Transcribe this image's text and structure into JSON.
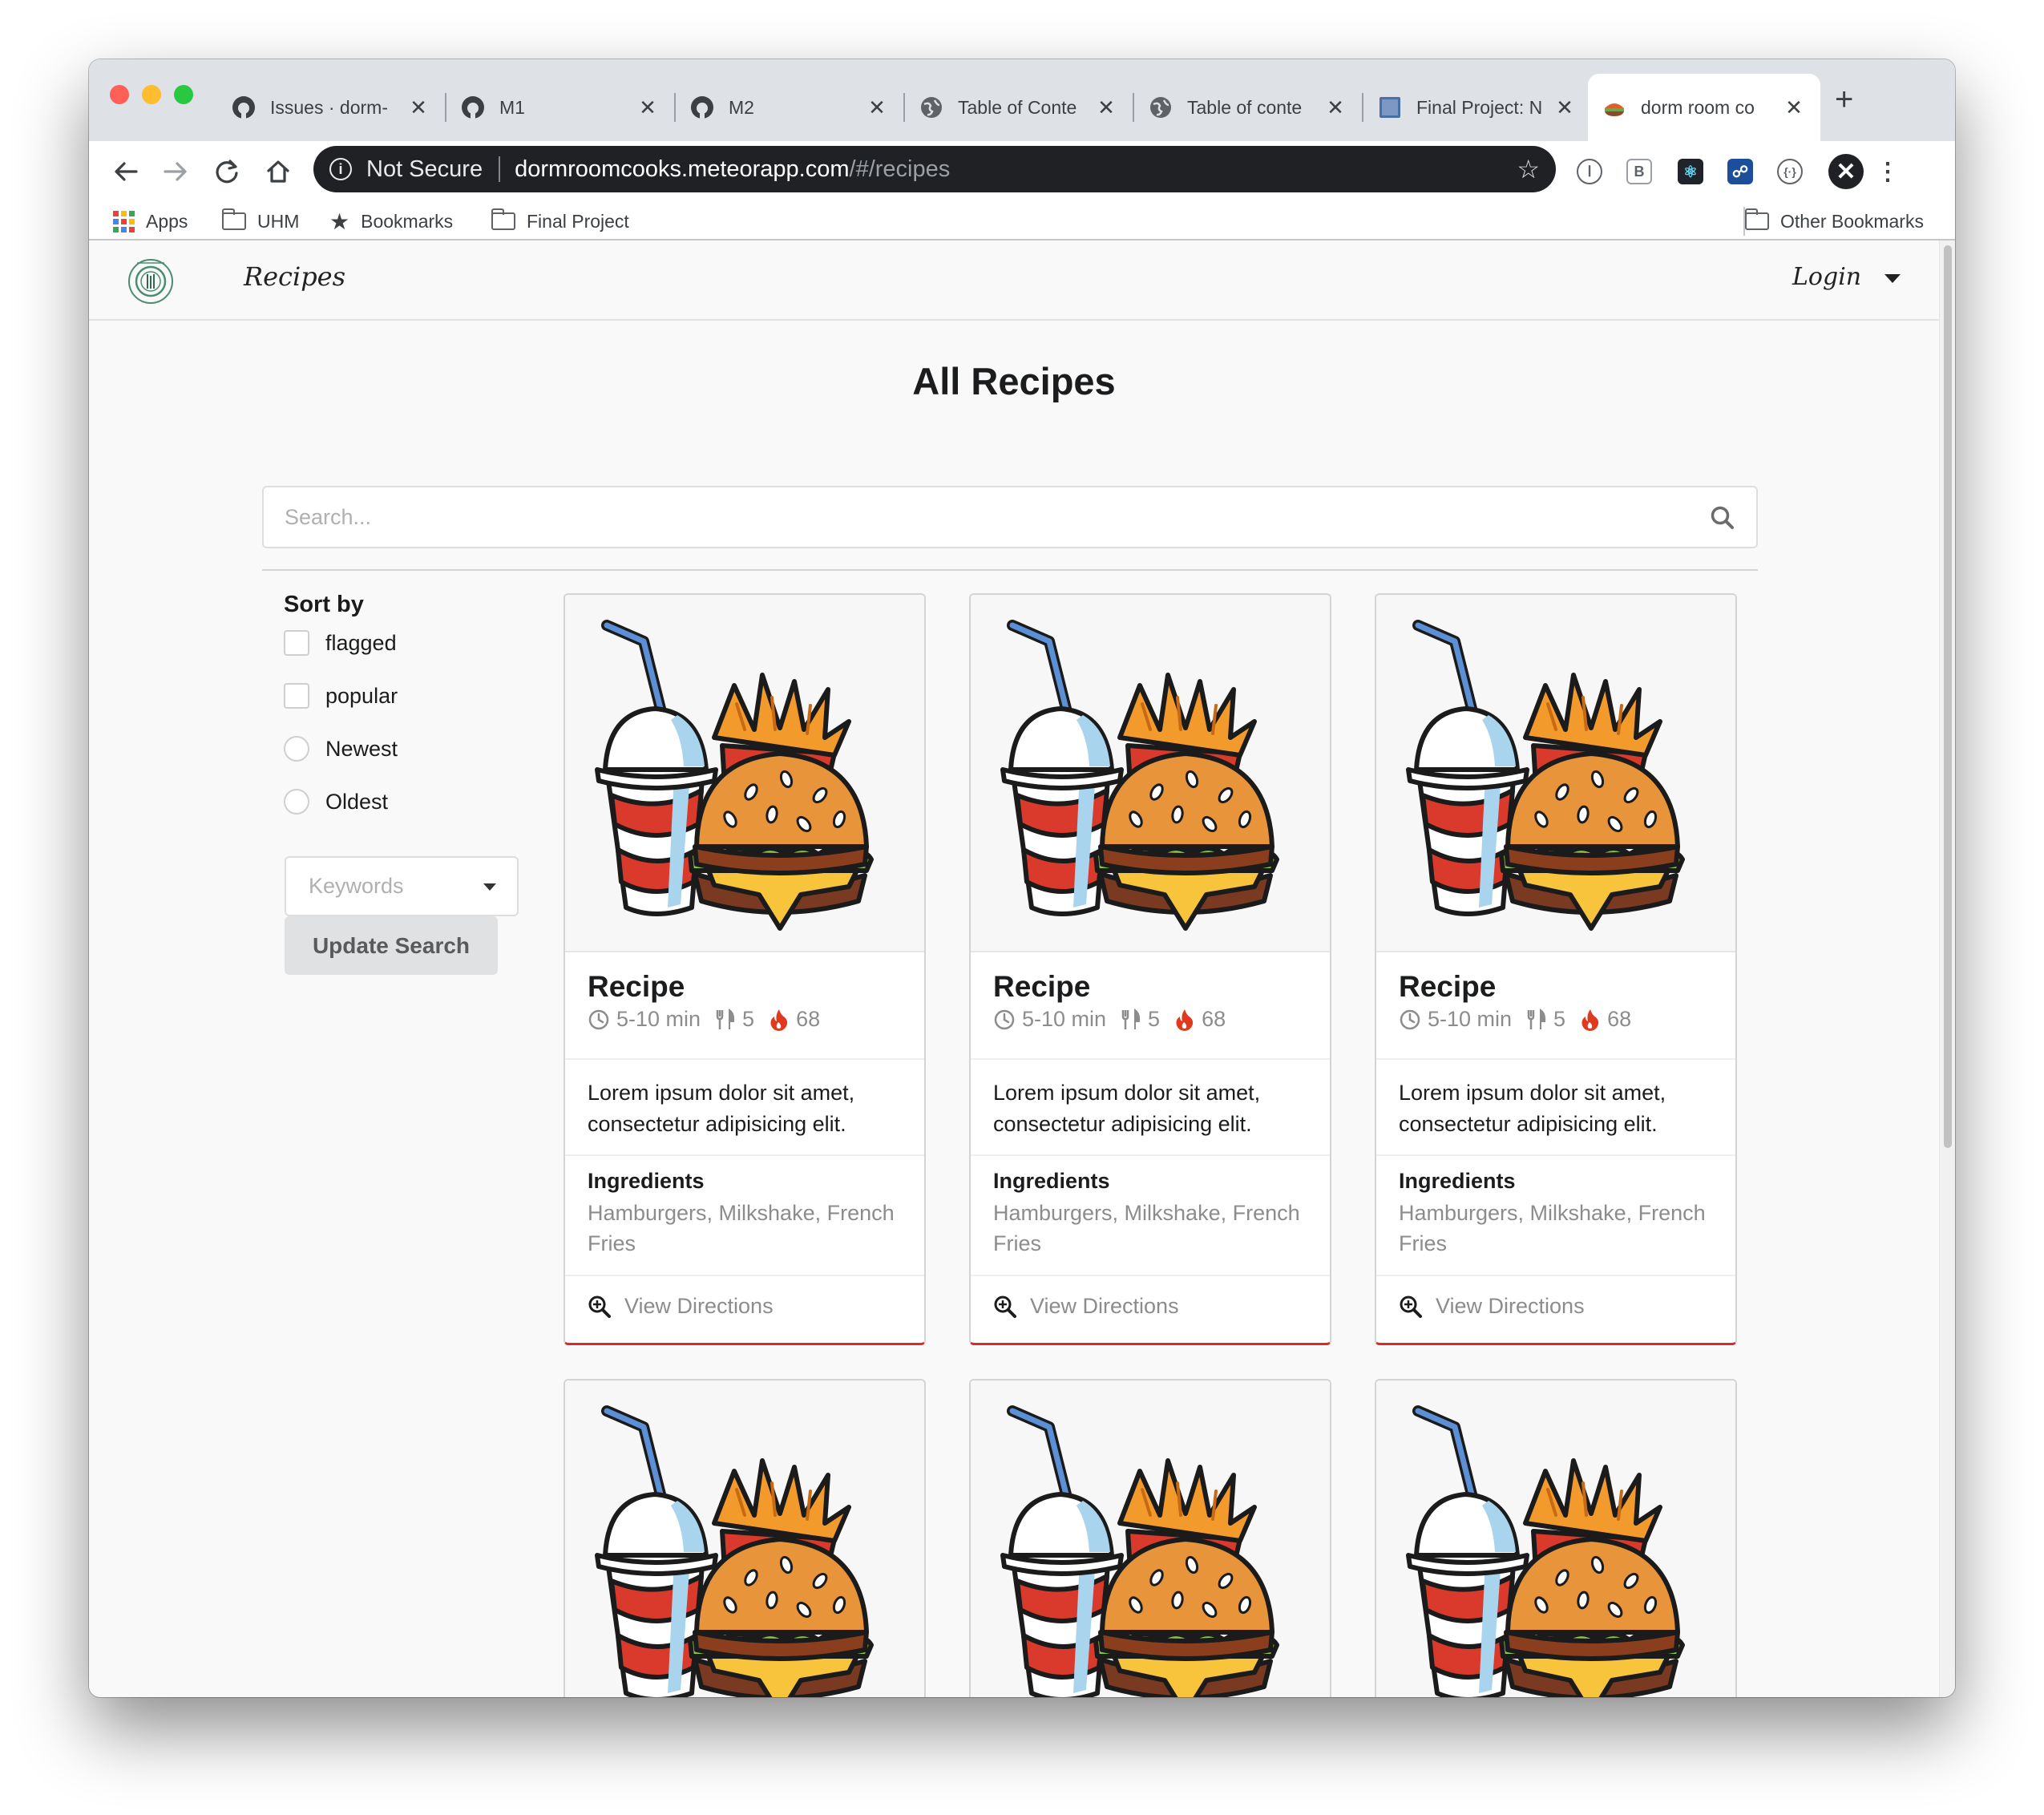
{
  "browser": {
    "tabs": [
      {
        "title": "Issues · dorm-",
        "icon": "github-icon"
      },
      {
        "title": "M1",
        "icon": "github-icon"
      },
      {
        "title": "M2",
        "icon": "github-icon"
      },
      {
        "title": "Table of Conte",
        "icon": "globe-icon"
      },
      {
        "title": "Table of conte",
        "icon": "globe-icon"
      },
      {
        "title": "Final Project: N",
        "icon": "document-icon"
      },
      {
        "title": "dorm room co",
        "icon": "food-favicon-icon",
        "active": true
      }
    ],
    "new_tab": "+",
    "omnibox": {
      "security": "Not Secure",
      "url_host": "dormroomcooks.meteorapp.com",
      "url_path": "/#/recipes"
    },
    "bookmarks": [
      {
        "label": "Apps",
        "icon": "apps-grid-icon"
      },
      {
        "label": "UHM",
        "icon": "folder-icon"
      },
      {
        "label": "Bookmarks",
        "icon": "star-icon"
      },
      {
        "label": "Final Project",
        "icon": "folder-icon"
      }
    ],
    "other_bookmarks": "Other Bookmarks"
  },
  "navbar": {
    "link": "Recipes",
    "login": "Login"
  },
  "page": {
    "title": "All Recipes",
    "search_placeholder": "Search...",
    "sort_label": "Sort by",
    "sort_options": [
      {
        "label": "flagged",
        "type": "checkbox",
        "checked": false
      },
      {
        "label": "popular",
        "type": "checkbox",
        "checked": false
      },
      {
        "label": "Newest",
        "type": "radio",
        "checked": false
      },
      {
        "label": "Oldest",
        "type": "radio",
        "checked": false
      }
    ],
    "keywords_placeholder": "Keywords",
    "update_button": "Update Search"
  },
  "recipes": [
    {
      "name": "Recipe",
      "time": "5-10 min",
      "servings": "5",
      "popularity": "68",
      "description": "Lorem ipsum dolor sit amet, consectetur adipisicing elit.",
      "ingredients_label": "Ingredients",
      "ingredients": "Hamburgers, Milkshake, French Fries",
      "directions": "View Directions"
    },
    {
      "name": "Recipe",
      "time": "5-10 min",
      "servings": "5",
      "popularity": "68",
      "description": "Lorem ipsum dolor sit amet, consectetur adipisicing elit.",
      "ingredients_label": "Ingredients",
      "ingredients": "Hamburgers, Milkshake, French Fries",
      "directions": "View Directions"
    },
    {
      "name": "Recipe",
      "time": "5-10 min",
      "servings": "5",
      "popularity": "68",
      "description": "Lorem ipsum dolor sit amet, consectetur adipisicing elit.",
      "ingredients_label": "Ingredients",
      "ingredients": "Hamburgers, Milkshake, French Fries",
      "directions": "View Directions"
    }
  ],
  "colors": {
    "accent_red": "#db2828",
    "flame": "#e03a1e"
  }
}
